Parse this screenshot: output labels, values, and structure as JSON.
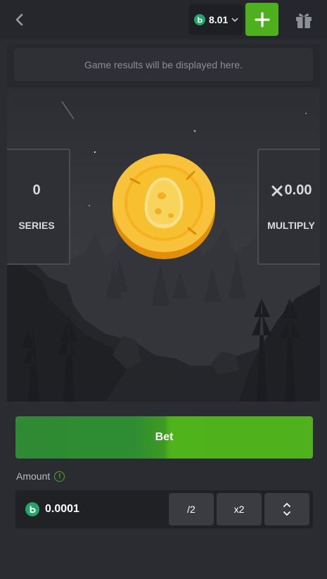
{
  "header": {
    "balance": "8.01",
    "icons": [
      "chevron-left-icon",
      "coin-icon",
      "chevron-down-icon",
      "plus-icon",
      "gift-icon"
    ]
  },
  "results": {
    "placeholder": "Game results will be displayed here."
  },
  "game": {
    "series": {
      "value": "0",
      "label": "SERIES"
    },
    "multiply": {
      "value": "0.00",
      "label": "MULTIPLY"
    }
  },
  "bet": {
    "label": "Bet",
    "amount_label": "Amount",
    "amount_value": "0.0001",
    "half_label": "/2",
    "double_label": "x2"
  },
  "colors": {
    "accent_green": "#4fb01f",
    "coin_badge": "#23a56a",
    "coin_gold": "#f5b822",
    "background": "#2a2c31"
  }
}
